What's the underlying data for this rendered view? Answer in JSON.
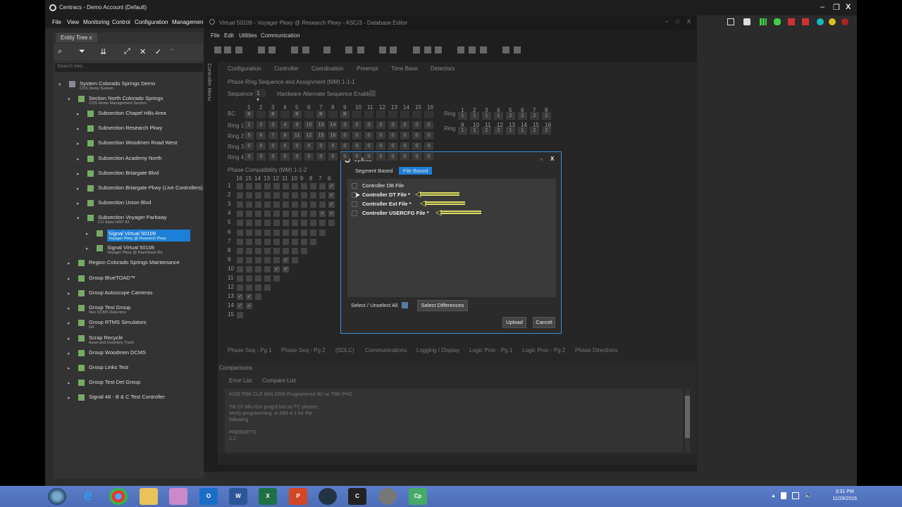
{
  "app": {
    "title": "Centracs - Demo Account (Default)",
    "menu": [
      "File",
      "View",
      "Monitoring",
      "Control",
      "Configuration",
      "Management"
    ]
  },
  "tree": {
    "tab": "Entity Tree",
    "search_placeholder": "Search tree...",
    "items": [
      {
        "label": "System  Colorado Springs Demo",
        "sub": "COS Demo System"
      },
      {
        "label": "Section  North Colorado Springs",
        "sub": "COS Demo Management Section"
      },
      {
        "label": "Subsection  Chapel Hills Area",
        "sub": ""
      },
      {
        "label": "Subsection  Research Pkwy",
        "sub": ""
      },
      {
        "label": "Subsection  Woodmen Road West",
        "sub": ""
      },
      {
        "label": "Subsection  Academy North",
        "sub": ""
      },
      {
        "label": "Subsection  Briargate Blvd",
        "sub": ""
      },
      {
        "label": "Subsection  Briargate Pkwy (Live Controllers)",
        "sub": ""
      },
      {
        "label": "Subsection  Union Blvd",
        "sub": ""
      },
      {
        "label": "Subsection  Voyager Parkway",
        "sub": "CO State HWY 83"
      },
      {
        "label": "Signal  Virtual 50109",
        "sub": "Voyager Pkwy @ Research Pkwy"
      },
      {
        "label": "Signal  Virtual 50108",
        "sub": "Voyager Pkwy @ Razorback Rd."
      },
      {
        "label": "Region  Colorado Springs Maintenance",
        "sub": ""
      },
      {
        "label": "Group  BlueTOAD™",
        "sub": ""
      },
      {
        "label": "Group  Autoscope Cameras",
        "sub": ""
      },
      {
        "label": "Group  Test Group",
        "sub": "Non DCMS Detectors"
      },
      {
        "label": "Group  RTMS Simulators",
        "sub": "G4"
      },
      {
        "label": "Scrap  Recycle",
        "sub": "Asset and Inventory Trash"
      },
      {
        "label": "Group  Woodmen DCMS",
        "sub": ""
      },
      {
        "label": "Group  Links Test",
        "sub": ""
      },
      {
        "label": "Group  Test Det Group",
        "sub": ""
      },
      {
        "label": "Signal  48 - B & C Test Controller",
        "sub": ""
      }
    ]
  },
  "editor": {
    "title": "Virtual 50109 - Voyager Pkwy @ Research Pkwy - ASC/3 - Database Editor",
    "menu": [
      "File",
      "Edit",
      "Utilities",
      "Communication"
    ],
    "side_label": "Controller Menu",
    "tabs": [
      "Configuration",
      "Controller",
      "Coordination",
      "Preempt",
      "Time Base",
      "Detectors"
    ],
    "ring_title": "Phase Ring Sequence and Assignment (MM) 1-1-1",
    "sequence_label": "Sequence",
    "sequence_value": "1",
    "hw_alt": "Hardware Alternate Sequence Enable",
    "phase_nums": [
      "1",
      "2",
      "3",
      "4",
      "5",
      "6",
      "7",
      "8",
      "9",
      "10",
      "11",
      "12",
      "13",
      "14",
      "15",
      "16"
    ],
    "bc_label": "BC",
    "bc_cell": "B",
    "rings": [
      {
        "label": "Ring 1",
        "values": [
          "1",
          "2",
          "3",
          "4",
          "9",
          "10",
          "13",
          "14",
          "0",
          "0",
          "0",
          "0",
          "0",
          "0",
          "0",
          "0"
        ]
      },
      {
        "label": "Ring 2",
        "values": [
          "5",
          "6",
          "7",
          "8",
          "11",
          "12",
          "15",
          "16",
          "0",
          "0",
          "0",
          "0",
          "0",
          "0",
          "0",
          "0"
        ]
      },
      {
        "label": "Ring 3",
        "values": [
          "0",
          "0",
          "0",
          "0",
          "0",
          "0",
          "0",
          "0",
          "0",
          "0",
          "0",
          "0",
          "0",
          "0",
          "0",
          "0"
        ]
      },
      {
        "label": "Ring 4",
        "values": [
          "0",
          "0",
          "0",
          "0",
          "0",
          "0",
          "0",
          "0",
          "0",
          "0",
          "0",
          "0",
          "0",
          "0",
          "0",
          "0"
        ]
      }
    ],
    "ring_assign_label": "Ring",
    "ring_assign_a": {
      "phases": [
        "1",
        "2",
        "3",
        "4",
        "5",
        "6",
        "7",
        "8"
      ],
      "values": [
        "1",
        "1",
        "1",
        "1",
        "2",
        "2",
        "2",
        "2"
      ]
    },
    "ring_assign_b": {
      "phases": [
        "9",
        "10",
        "11",
        "12",
        "13",
        "14",
        "15",
        "16"
      ],
      "values": [
        "1",
        "1",
        "2",
        "2",
        "1",
        "1",
        "2",
        "2"
      ]
    },
    "compat_title": "Phase Compatibility (MM) 1-1-2",
    "compat_cols": [
      "16",
      "15",
      "14",
      "13",
      "12",
      "11",
      "10",
      "9",
      "8",
      "7",
      "6"
    ],
    "compat_rows": [
      "1",
      "2",
      "3",
      "4",
      "5",
      "6",
      "7",
      "8",
      "9",
      "10",
      "11",
      "12",
      "13",
      "14",
      "15"
    ],
    "bottom_tabs": [
      "Phase Seq - Pg 1",
      "Phase Seq - Pg 2",
      "(SDLC)",
      "Communications",
      "Logging / Display",
      "Logic Proc - Pg 1",
      "Logic Proc - Pg 2",
      "Phase Directions"
    ],
    "comparisons": {
      "title": "Comparisons",
      "tabs": [
        "Error List",
        "Compare List"
      ],
      "text": "4105-TRK CLR MIN GRN Programmed W/ no TRK PHS\n\nTrk Clr Min Grn prog'd but no TC phases\nVerify programming  in MM-4-1 for the\nfollowing\n\nPREEMPTS:\n1,2"
    }
  },
  "modal": {
    "title": "Upload",
    "tabs": [
      "Segment Based",
      "File Based"
    ],
    "files": [
      {
        "label": "Controller DB File",
        "highlight": false
      },
      {
        "label": "Controller DT File *",
        "highlight": true
      },
      {
        "label": "Controller Ext File *",
        "highlight": true
      },
      {
        "label": "Controller USERCFG File *",
        "highlight": true
      }
    ],
    "select_all": "Select / Unselect All",
    "select_diff": "Select Differences",
    "upload": "Upload",
    "cancel": "Cancel"
  },
  "taskbar": {
    "time": "3:31 PM",
    "date": "11/29/2016"
  },
  "colors": {
    "accent": "#3a8fd6",
    "selected": "#1e7fd6",
    "arrow": "#dde060"
  }
}
